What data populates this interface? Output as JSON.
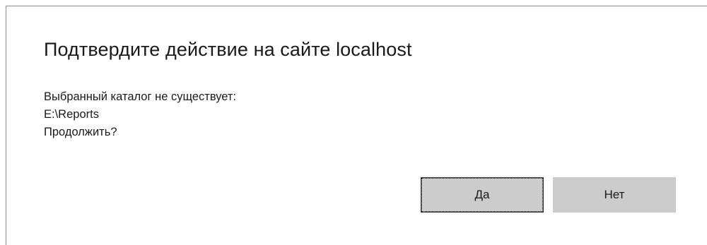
{
  "dialog": {
    "title": "Подтвердите действие на сайте localhost",
    "message_lines": [
      "Выбранный каталог не существует:",
      "E:\\Reports",
      "Продолжить?"
    ],
    "buttons": {
      "yes_label": "Да",
      "no_label": "Нет"
    },
    "focused_button": "yes"
  },
  "colors": {
    "background": "#ffffff",
    "button_background": "#cccccc",
    "text": "#1a1a1a",
    "border": "#8a8a8a"
  }
}
